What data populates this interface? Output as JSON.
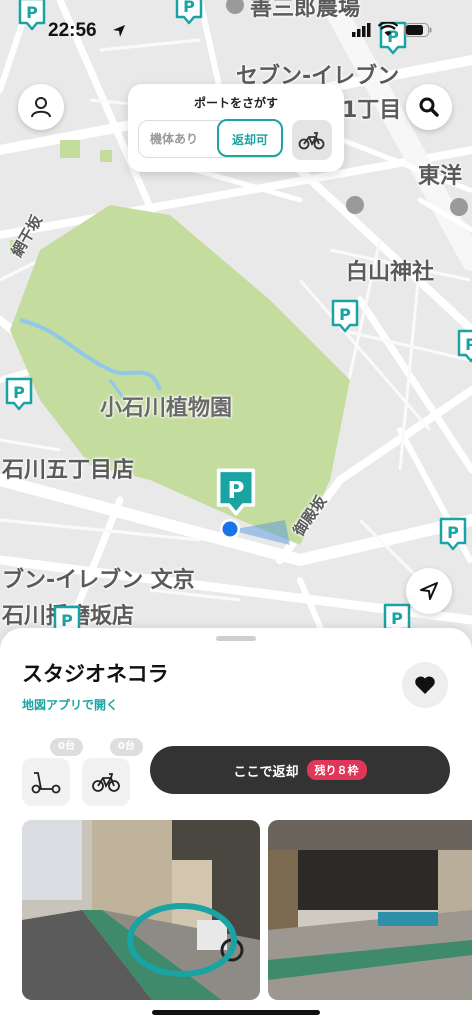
{
  "status_bar": {
    "time": "22:56"
  },
  "map": {
    "labels": {
      "farm": "善三郎農場",
      "seven_top_1": "セブン-イレブン",
      "seven_top_2": "1丁目",
      "toyo": "東洋",
      "hakusan": "白山神社",
      "amihozaka": "網干坂",
      "koishikawa": "小石川植物園",
      "store_5chome": "石川五丁目店",
      "gotenzaka": "御殿坂",
      "seven_bottom_1": "ブン-イレブン 文京",
      "seven_bottom_2": "石川播磨坂店"
    },
    "pin_letter": "P"
  },
  "search_card": {
    "title": "ポートをさがす",
    "filter_available": "機体あり",
    "filter_returnable": "返却可"
  },
  "port": {
    "name": "スタジオネコラ",
    "map_link": "地図アプリで開く",
    "scooter_count": "0台",
    "bike_count": "0台",
    "return_button": "ここで返却",
    "remaining_badge": "残り８枠"
  },
  "colors": {
    "accent": "#1aa3a3",
    "badge": "#e0365a",
    "park": "#c5dc9f"
  }
}
